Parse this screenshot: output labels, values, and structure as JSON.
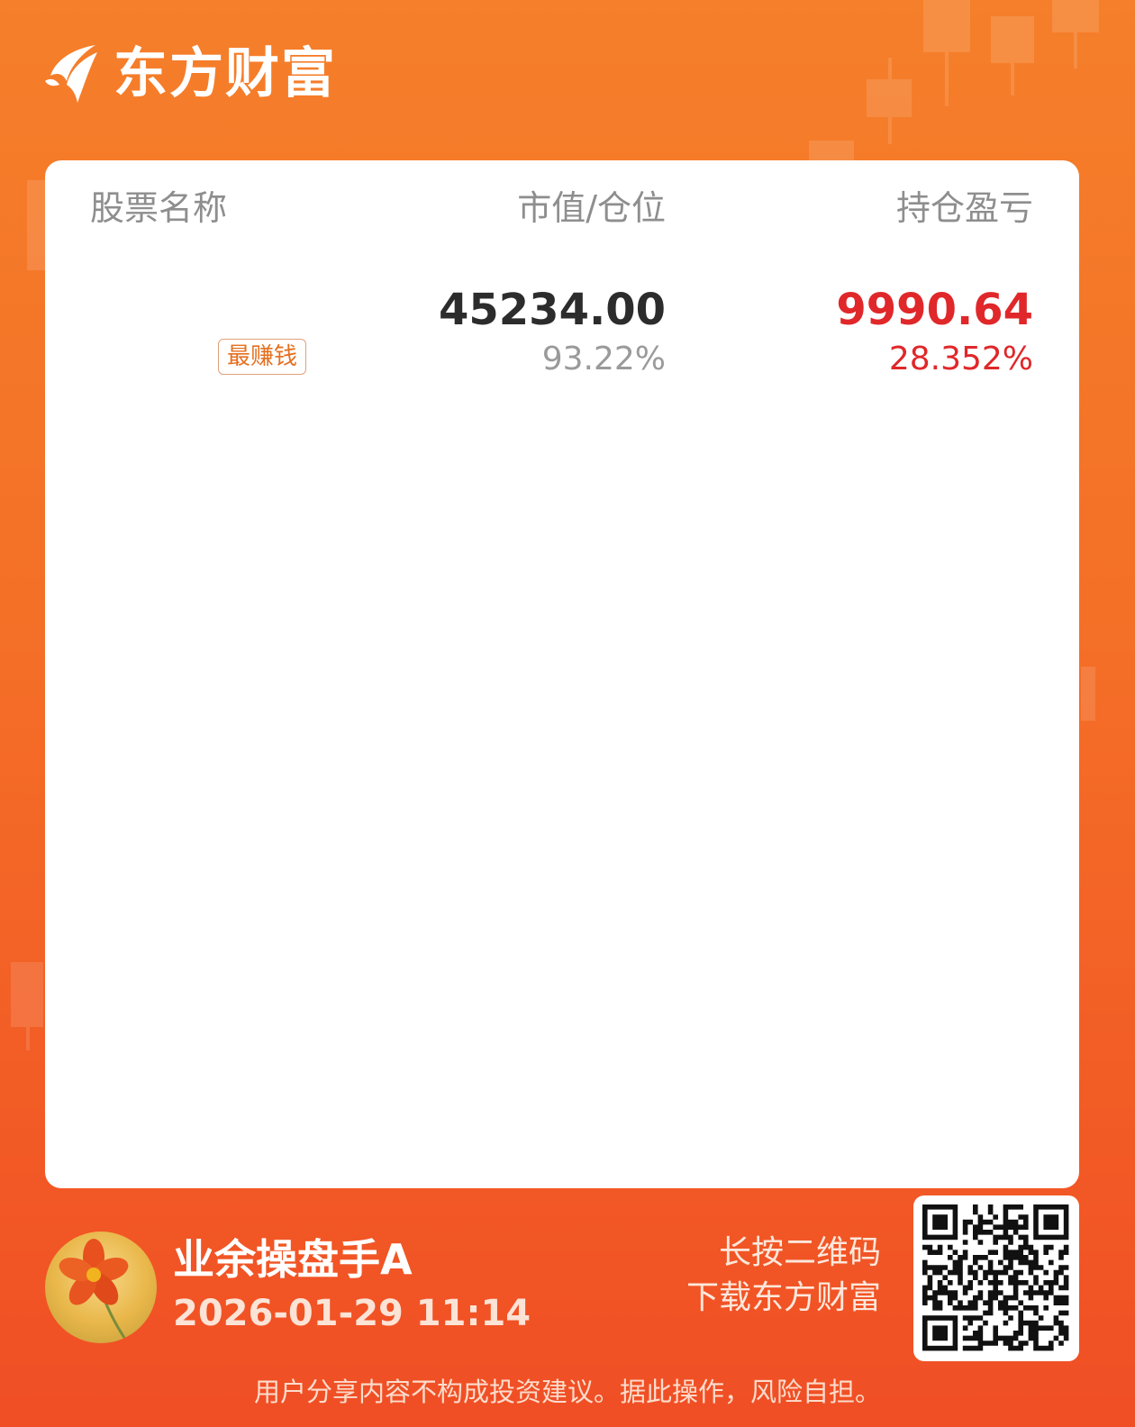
{
  "brand": {
    "name": "东方财富"
  },
  "table": {
    "headers": [
      "股票名称",
      "市值/仓位",
      "持仓盈亏"
    ],
    "rows": [
      {
        "name": "",
        "badge": "最赚钱",
        "market_value": "45234.00",
        "position_pct": "93.22%",
        "pnl": "9990.64",
        "pnl_pct": "28.352%"
      }
    ]
  },
  "user": {
    "name": "业余操盘手A",
    "timestamp": "2026-01-29 11:14"
  },
  "qr": {
    "hint_line1": "长按二维码",
    "hint_line2": "下载东方财富"
  },
  "disclaimer": "用户分享内容不构成投资建议。据此操作，风险自担。",
  "colors": {
    "accent": "#f46f27",
    "profit_red": "#e0272a",
    "badge_orange": "#e56f1f"
  }
}
